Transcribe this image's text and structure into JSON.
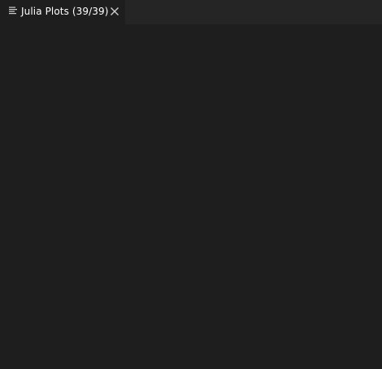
{
  "colors": {
    "background": "#1e1e1e",
    "tab_bar": "#252526",
    "tab_active": "#1e1e1e",
    "tab_text": "#ffffff",
    "icon": "#cccccc"
  },
  "tabs": [
    {
      "label": "Julia Plots (39/39)",
      "icon": "preview-lines-icon",
      "close_icon": "close-icon",
      "active": true
    }
  ]
}
